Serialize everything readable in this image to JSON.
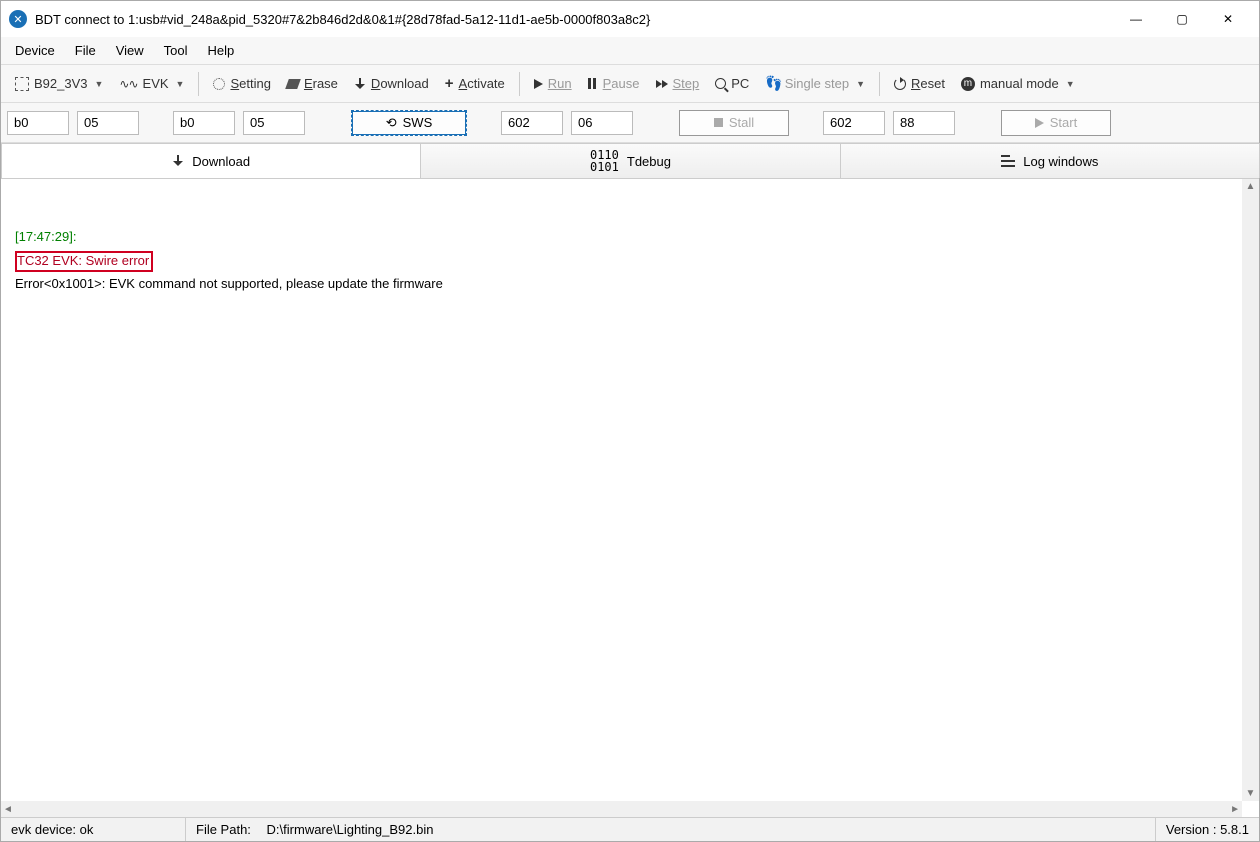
{
  "window": {
    "title": "BDT connect to 1:usb#vid_248a&pid_5320#7&2b846d2d&0&1#{28d78fad-5a12-11d1-ae5b-0000f803a8c2}"
  },
  "menu": {
    "device": "Device",
    "file": "File",
    "view": "View",
    "tool": "Tool",
    "help": "Help"
  },
  "toolbar": {
    "chip": "B92_3V3",
    "evk": "EVK",
    "setting": "Setting",
    "erase": "Erase",
    "download": "Download",
    "activate": "Activate",
    "run": "Run",
    "pause": "Pause",
    "step": "Step",
    "pc": "PC",
    "singlestep": "Single step",
    "reset": "Reset",
    "manual": "manual mode"
  },
  "inputs": {
    "a1": "b0",
    "a2": "05",
    "a3": "b0",
    "a4": "05",
    "sws": "SWS",
    "b1": "602",
    "b2": "06",
    "stall": "Stall",
    "c1": "602",
    "c2": "88",
    "start": "Start"
  },
  "tabs": {
    "download": "Download",
    "tdebug": "Tdebug",
    "log": "Log windows"
  },
  "log": {
    "line1": "[17:47:29]:",
    "line2": "TC32 EVK: Swire error",
    "line3": "Error<0x1001>: EVK command not supported, please update the firmware"
  },
  "status": {
    "device": "evk device: ok",
    "path_label": "File Path:",
    "path_value": "D:\\firmware\\Lighting_B92.bin",
    "version": "Version : 5.8.1"
  }
}
